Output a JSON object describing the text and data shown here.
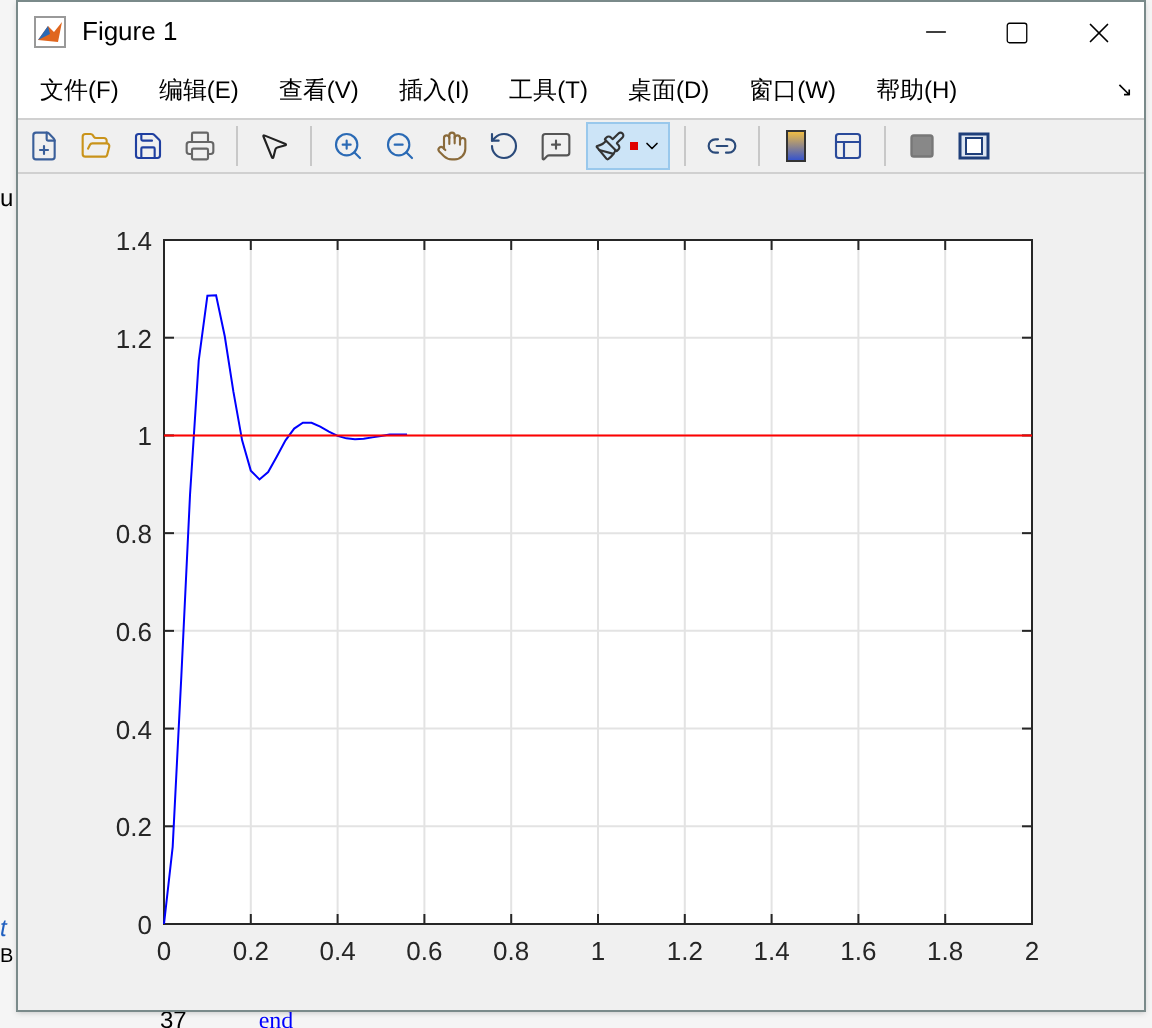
{
  "window": {
    "title": "Figure 1"
  },
  "menu": [
    {
      "label": "文件(F)"
    },
    {
      "label": "编辑(E)"
    },
    {
      "label": "查看(V)"
    },
    {
      "label": "插入(I)"
    },
    {
      "label": "工具(T)"
    },
    {
      "label": "桌面(D)"
    },
    {
      "label": "窗口(W)"
    },
    {
      "label": "帮助(H)"
    }
  ],
  "dock_arrow": "↘",
  "toolbar": [
    {
      "kind": "new",
      "selected": false
    },
    {
      "kind": "open",
      "selected": false
    },
    {
      "kind": "save",
      "selected": false
    },
    {
      "kind": "print",
      "selected": false
    },
    {
      "kind": "separator"
    },
    {
      "kind": "pointer",
      "selected": false
    },
    {
      "kind": "separator"
    },
    {
      "kind": "zoom-in",
      "selected": false
    },
    {
      "kind": "zoom-out",
      "selected": false
    },
    {
      "kind": "pan",
      "selected": false
    },
    {
      "kind": "rotate",
      "selected": false
    },
    {
      "kind": "data-cursor",
      "selected": false
    },
    {
      "kind": "brush",
      "selected": true
    },
    {
      "kind": "separator"
    },
    {
      "kind": "link",
      "selected": false
    },
    {
      "kind": "separator"
    },
    {
      "kind": "colorbar",
      "selected": false
    },
    {
      "kind": "legend",
      "selected": false
    },
    {
      "kind": "separator"
    },
    {
      "kind": "hide-tools",
      "selected": false
    },
    {
      "kind": "show-tools",
      "selected": false
    }
  ],
  "figure": {
    "chart_data": {
      "type": "line",
      "grid": true,
      "x": [
        0,
        0.02,
        0.04,
        0.06,
        0.08,
        0.1,
        0.12,
        0.14,
        0.16,
        0.18,
        0.2,
        0.22,
        0.24,
        0.26,
        0.28,
        0.3,
        0.32,
        0.34,
        0.36,
        0.38,
        0.4,
        0.42,
        0.44,
        0.46,
        0.48,
        0.5,
        0.52,
        0.54,
        0.56,
        0.6,
        0.8,
        1,
        1.2,
        1.4,
        1.6,
        1.8,
        2
      ],
      "series": [
        {
          "color": "#0000ff",
          "values": [
            0,
            0.158,
            0.508,
            0.879,
            1.153,
            1.286,
            1.287,
            1.203,
            1.089,
            0.99,
            0.928,
            0.91,
            0.925,
            0.957,
            0.99,
            1.014,
            1.026,
            1.026,
            1.018,
            1.008,
            0.999,
            0.994,
            0.992,
            0.993,
            0.996,
            0.999,
            1.002,
            1.002,
            1.002,
            null,
            null,
            null,
            null,
            null,
            null,
            null,
            null
          ]
        },
        {
          "color": "#ff0000",
          "values": [
            1,
            1,
            1,
            1,
            1,
            1,
            1,
            1,
            1,
            1,
            1,
            1,
            1,
            1,
            1,
            1,
            1,
            1,
            1,
            1,
            1,
            1,
            1,
            1,
            1,
            1,
            1,
            1,
            1,
            1,
            1,
            1,
            1,
            1,
            1,
            1,
            1
          ]
        }
      ],
      "xlim": [
        0,
        2
      ],
      "ylim": [
        0,
        1.4
      ],
      "xticks": [
        0,
        {
          "value": 0.2,
          "label": "0.2"
        },
        {
          "value": 0.4,
          "label": "0.4"
        },
        {
          "value": 0.6,
          "label": "0.6"
        },
        {
          "value": 0.8,
          "label": "0.8"
        },
        1,
        {
          "value": 1.2,
          "label": "1.2"
        },
        {
          "value": 1.4,
          "label": "1.4"
        },
        {
          "value": 1.6,
          "label": "1.6"
        },
        {
          "value": 1.8,
          "label": "1.8"
        },
        2
      ],
      "yticks": [
        0,
        {
          "value": 0.2,
          "label": "0.2"
        },
        {
          "value": 0.4,
          "label": "0.4"
        },
        {
          "value": 0.6,
          "label": "0.6"
        },
        {
          "value": 0.8,
          "label": "0.8"
        },
        1,
        {
          "value": 1.2,
          "label": "1.2"
        },
        {
          "value": 1.4,
          "label": "1.4"
        }
      ]
    }
  },
  "background": {
    "fragments": [
      "u",
      "t",
      "B"
    ],
    "line_number": "37",
    "code": "end"
  }
}
